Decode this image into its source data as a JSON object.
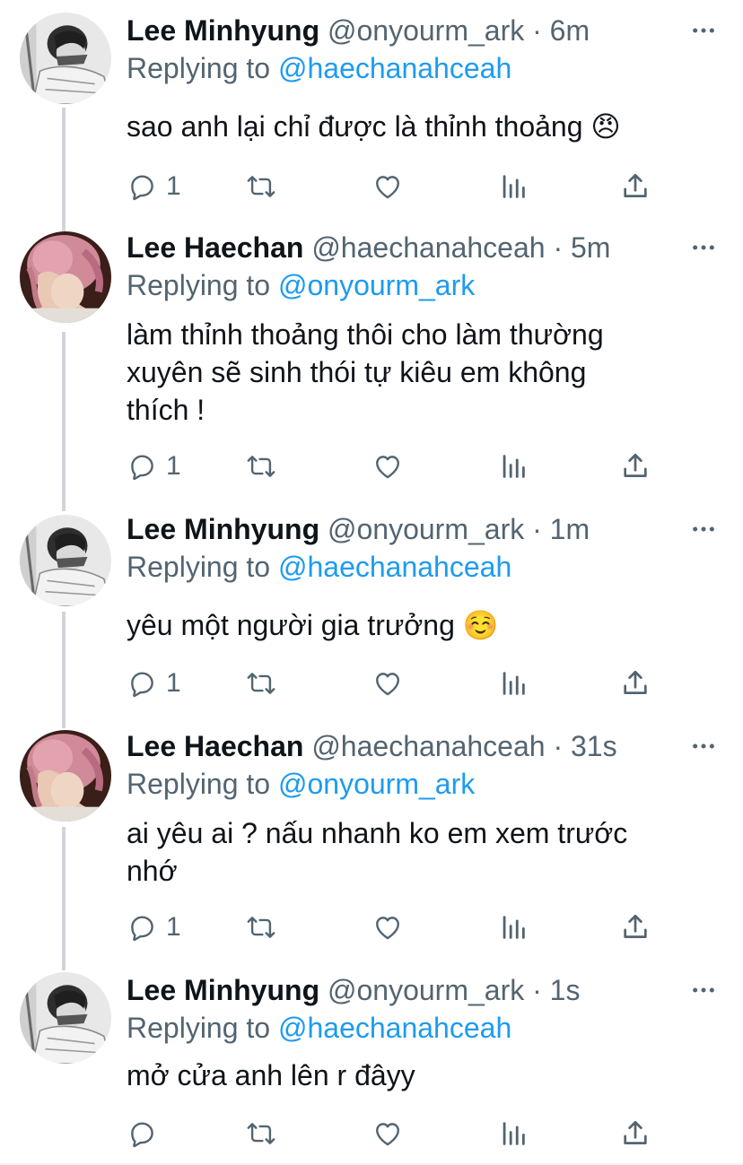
{
  "colors": {
    "accent": "#1d9bf0",
    "secondary_text": "#536471",
    "primary_text": "#0f1419",
    "thread_line": "#d0d5d9"
  },
  "icons": {
    "more": "more-horizontal-icon",
    "reply": "reply-icon",
    "retweet": "retweet-icon",
    "like": "heart-icon",
    "stats": "stats-icon",
    "share": "share-icon"
  },
  "tweets": [
    {
      "name": "Lee Minhyung",
      "handle": "@onyourm_ark",
      "dot": "·",
      "time": "6m",
      "replying_prefix": "Replying to",
      "replying_to": "@haechanahceah",
      "text": "sao anh lại chỉ được là thỉnh thoảng",
      "emoji": "😠",
      "reply_count": "1"
    },
    {
      "name": "Lee Haechan",
      "handle": "@haechanahceah",
      "dot": "·",
      "time": "5m",
      "replying_prefix": "Replying to",
      "replying_to": "@onyourm_ark",
      "text_lines": [
        "làm thỉnh thoảng thôi cho làm thường",
        "xuyên sẽ sinh thói tự kiêu em không",
        "thích !"
      ],
      "reply_count": "1"
    },
    {
      "name": "Lee Minhyung",
      "handle": "@onyourm_ark",
      "dot": "·",
      "time": "1m",
      "replying_prefix": "Replying to",
      "replying_to": "@haechanahceah",
      "text": "yêu một người gia trưởng",
      "emoji": "☺️",
      "reply_count": "1"
    },
    {
      "name": "Lee Haechan",
      "handle": "@haechanahceah",
      "dot": "·",
      "time": "31s",
      "replying_prefix": "Replying to",
      "replying_to": "@onyourm_ark",
      "text_lines": [
        "ai yêu ai ? nấu nhanh ko em xem trước",
        "nhớ"
      ],
      "reply_count": "1"
    },
    {
      "name": "Lee Minhyung",
      "handle": "@onyourm_ark",
      "dot": "·",
      "time": "1s",
      "replying_prefix": "Replying to",
      "replying_to": "@haechanahceah",
      "text": "mở cửa anh lên r đâyy",
      "reply_count": ""
    }
  ]
}
